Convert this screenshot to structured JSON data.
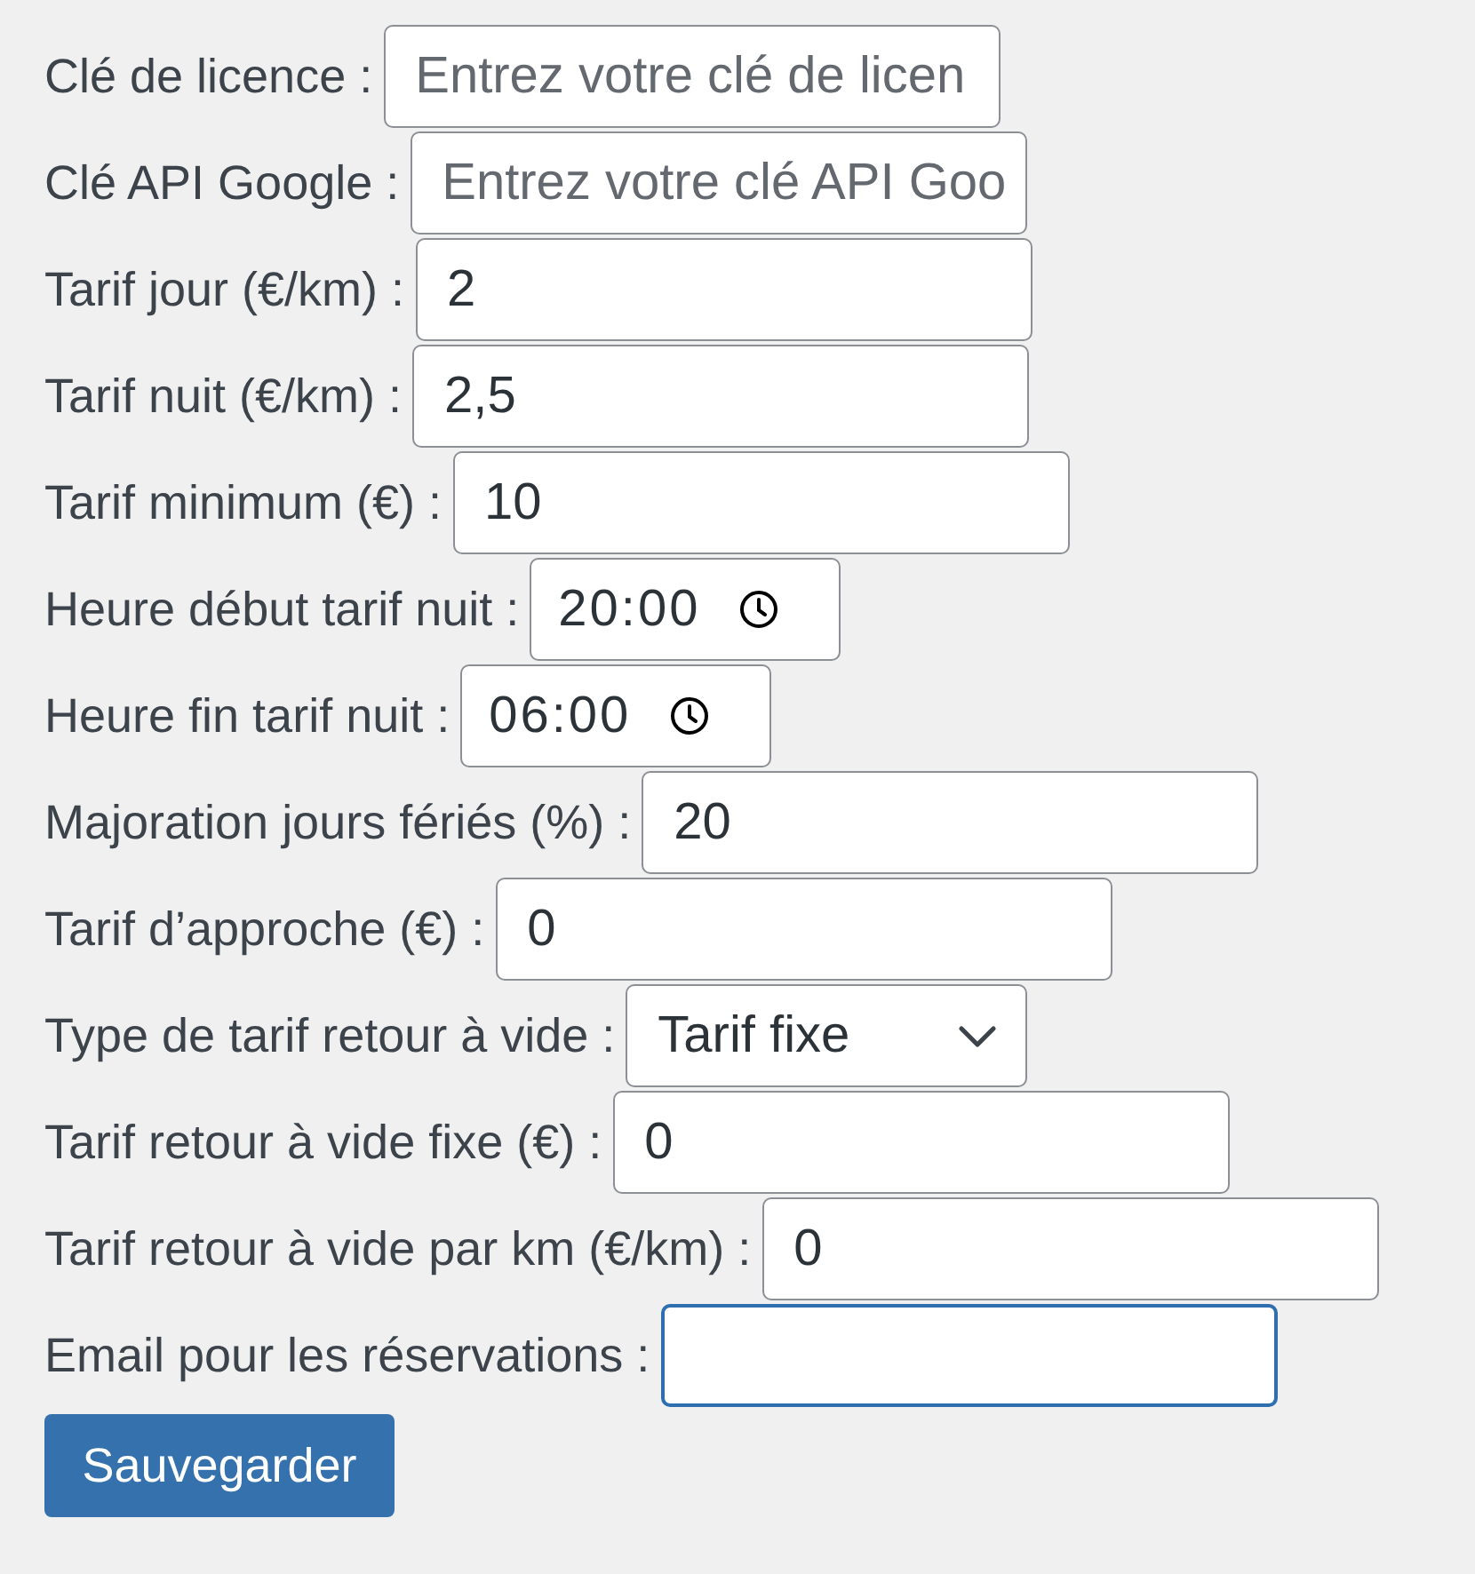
{
  "fields": [
    {
      "label": "Clé de licence :",
      "kind": "text",
      "placeholder": "Entrez votre clé de licen",
      "focused": false
    },
    {
      "label": "Clé API Google :",
      "kind": "text",
      "placeholder": "Entrez votre clé API Goo",
      "focused": false
    },
    {
      "label": "Tarif jour (€/km) :",
      "kind": "text",
      "value": "2",
      "focused": false
    },
    {
      "label": "Tarif nuit (€/km) :",
      "kind": "text",
      "value": "2,5",
      "focused": false
    },
    {
      "label": "Tarif minimum (€) :",
      "kind": "text",
      "value": "10",
      "focused": false
    },
    {
      "label": "Heure début tarif nuit :",
      "kind": "time",
      "value": "20:00",
      "focused": false
    },
    {
      "label": "Heure fin tarif nuit :",
      "kind": "time",
      "value": "06:00",
      "focused": false
    },
    {
      "label": "Majoration jours fériés (%) :",
      "kind": "text",
      "value": "20",
      "focused": false
    },
    {
      "label": "Tarif d’approche (€) :",
      "kind": "text",
      "value": "0",
      "focused": false
    },
    {
      "label": "Type de tarif retour à vide :",
      "kind": "select",
      "value": "Tarif fixe",
      "focused": false
    },
    {
      "label": "Tarif retour à vide fixe (€) :",
      "kind": "text",
      "value": "0",
      "focused": false
    },
    {
      "label": "Tarif retour à vide par km (€/km) :",
      "kind": "text",
      "value": "0",
      "focused": false
    },
    {
      "label": "Email pour les réservations :",
      "kind": "text",
      "focused": true
    }
  ],
  "button": {
    "label": "Sauvegarder"
  }
}
